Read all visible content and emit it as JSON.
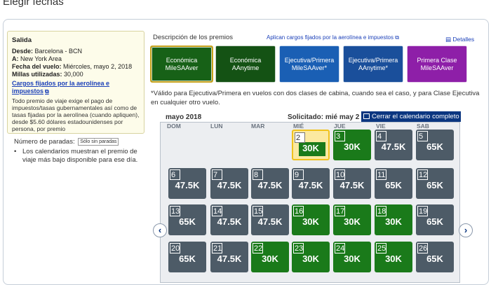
{
  "page": {
    "title": "Elegir fechas"
  },
  "summary": {
    "heading": "Salida",
    "from_label": "Desde:",
    "from_value": "Barcelona - BCN",
    "to_label": "A:",
    "to_value": "New York Area",
    "date_label": "Fecha del vuelo:",
    "date_value": "Miércoles, mayo 2, 2018",
    "miles_label": "Millas utilizadas:",
    "miles_value": "30,000",
    "fee_link": "Cargos fijados por la aerolínea e impuestos",
    "note": "Todo premio de viaje exige el pago de impuestos/tasas gubernamentales así como de tasas fijadas por la aerolínea (cuando apliquen), desde $5.60 dólares estadounidenses por persona, por premio"
  },
  "stops": {
    "label": "Número de paradas:",
    "selected": "Sólo sin paradas",
    "note": "Los calendarios muestran el premio de viaje más bajo disponible para ese día."
  },
  "awards": {
    "title": "Descripción de los premios",
    "apply_link": "Aplican cargos fijados por la aerolínea e impuestos",
    "details_link": "Detalles",
    "tiles": [
      {
        "line1": "Económica",
        "line2": "MileSAAver"
      },
      {
        "line1": "Económica",
        "line2": "AAnytime"
      },
      {
        "line1": "Ejecutiva/Primera",
        "line2": "MileSAAver*"
      },
      {
        "line1": "Ejecutiva/Primera",
        "line2": "AAnytime*"
      },
      {
        "line1": "Primera Clase",
        "line2": "MileSAAver"
      }
    ],
    "note": "*Válido para Ejecutiva/Primera en vuelos con dos clases de cabina, cuando sea el caso, y para Clase Ejecutiva en cualquier otro vuelo."
  },
  "calendar": {
    "month": "mayo 2018",
    "requested": "Solicitado: mié may 2",
    "close_button": "Cerrar el calendario completo",
    "days_of_week": [
      "DOM",
      "LUN",
      "MAR",
      "MIÉ",
      "JUE",
      "VIE",
      "SAB"
    ],
    "prev_arrow": "‹",
    "next_arrow": "›",
    "weeks": [
      [
        null,
        null,
        null,
        {
          "day": "2",
          "price": "30K",
          "style": "selected"
        },
        {
          "day": "3",
          "price": "30K",
          "style": "green"
        },
        {
          "day": "4",
          "price": "47.5K",
          "style": "gray"
        },
        {
          "day": "5",
          "price": "65K",
          "style": "gray"
        }
      ],
      [
        {
          "day": "6",
          "price": "47.5K",
          "style": "gray"
        },
        {
          "day": "7",
          "price": "47.5K",
          "style": "gray"
        },
        {
          "day": "8",
          "price": "47.5K",
          "style": "gray"
        },
        {
          "day": "9",
          "price": "47.5K",
          "style": "gray"
        },
        {
          "day": "10",
          "price": "47.5K",
          "style": "gray"
        },
        {
          "day": "11",
          "price": "65K",
          "style": "gray"
        },
        {
          "day": "12",
          "price": "65K",
          "style": "gray"
        }
      ],
      [
        {
          "day": "13",
          "price": "65K",
          "style": "gray"
        },
        {
          "day": "14",
          "price": "47.5K",
          "style": "gray"
        },
        {
          "day": "15",
          "price": "47.5K",
          "style": "gray"
        },
        {
          "day": "16",
          "price": "30K",
          "style": "green"
        },
        {
          "day": "17",
          "price": "30K",
          "style": "green"
        },
        {
          "day": "18",
          "price": "30K",
          "style": "green"
        },
        {
          "day": "19",
          "price": "65K",
          "style": "gray"
        }
      ],
      [
        {
          "day": "20",
          "price": "65K",
          "style": "gray"
        },
        {
          "day": "21",
          "price": "47.5K",
          "style": "gray"
        },
        {
          "day": "22",
          "price": "30K",
          "style": "green"
        },
        {
          "day": "23",
          "price": "30K",
          "style": "green"
        },
        {
          "day": "24",
          "price": "30K",
          "style": "green"
        },
        {
          "day": "25",
          "price": "30K",
          "style": "green"
        },
        {
          "day": "26",
          "price": "65K",
          "style": "gray"
        }
      ]
    ]
  },
  "colors": {
    "green": "#1a7a1a",
    "gray": "#4d5b67",
    "selected_border": "#f0c21c",
    "link": "#1a3fb8",
    "nav_blue": "#0b3680"
  }
}
